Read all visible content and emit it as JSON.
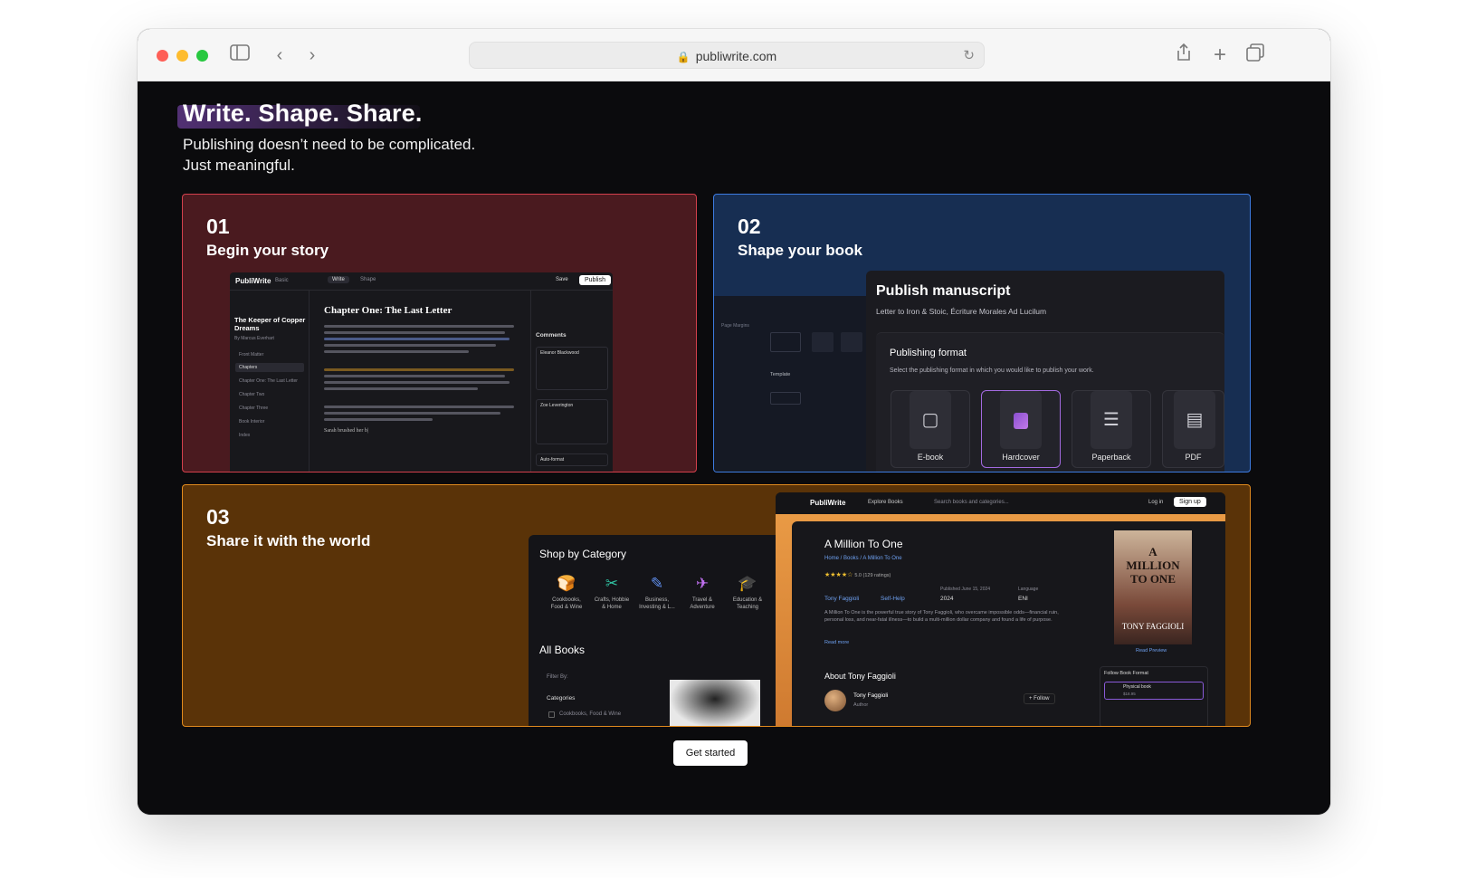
{
  "browser": {
    "url": "publiwrite.com"
  },
  "hero": {
    "title": "Write. Shape. Share.",
    "subtitle_line1": "Publishing doesn’t need to be complicated.",
    "subtitle_line2": "Just meaningful."
  },
  "cards": [
    {
      "number": "01",
      "title": "Begin your story",
      "editor": {
        "logo": "PubliWrite",
        "plan": "Basic",
        "tabs": [
          "Write",
          "Shape"
        ],
        "save": "Save",
        "publish": "Publish",
        "book_title": "The Keeper of Copper Dreams",
        "author": "By Marcus Everhart",
        "sections": [
          "Front Matter",
          "Chapters",
          "Chapter One: The Last Letter",
          "Chapter Two",
          "Chapter Three",
          "Book Interior",
          "Index"
        ],
        "chapter_heading": "Chapter One: The Last Letter",
        "comments_label": "Comments",
        "comment1": "Eleanor Blackwood",
        "comment2": "Zoe Leverington",
        "comment3": "Auto-format",
        "paragraph_end": "Sarah brushed her b|"
      }
    },
    {
      "number": "02",
      "title": "Shape your book",
      "publish": {
        "heading": "Publish manuscript",
        "sub": "Letter to Iron & Stoic, Écriture Morales Ad Lucilum",
        "format_title": "Publishing format",
        "format_desc": "Select the publishing format in which you would like to publish your work.",
        "formats": [
          "E-book",
          "Hardcover",
          "Paperback",
          "PDF"
        ],
        "side_labels": [
          "Page Margins",
          "Template"
        ]
      }
    },
    {
      "number": "03",
      "title": "Share it with the world",
      "store": {
        "shop_title": "Shop by Category",
        "categories": [
          "Cookbooks, Food & Wine",
          "Crafts, Hobbie & Home",
          "Business, Investing & L...",
          "Travel & Adventure",
          "Education & Teaching"
        ],
        "all_books": "All Books",
        "filter_by": "Filter By:",
        "categories_label": "Categories",
        "category_item": "Cookbooks, Food & Wine",
        "nav_logo": "PubliWrite",
        "explore": "Explore Books",
        "search_placeholder": "Search books and categories...",
        "login": "Log in",
        "signup": "Sign up",
        "book_title": "A Million To One",
        "breadcrumb": "Home / Books / A Million To One",
        "rating": "5.0 (129 ratings)",
        "author_name": "Tony Faggioli",
        "publisher": "Self-Help",
        "published_label": "Published June 15, 2024",
        "year": "2024",
        "language_label": "Language",
        "language": "ENI",
        "description": "A Million To One is the powerful true story of Tony Faggioli, who overcame impossible odds—financial ruin, personal loss, and near-fatal illness—to build a multi-million dollar company and found a life of purpose.",
        "read_more": "Read more",
        "about": "About Tony Faggioli",
        "author_role": "Author",
        "follow": "+ Follow",
        "cover_line1": "A",
        "cover_line2": "MILLION",
        "cover_line3": "TO ONE",
        "cover_author": "TONY FAGGIOLI",
        "read_preview": "Read Preview",
        "format_box_title": "Follow Book Format",
        "format_option": "Physical book",
        "format_price": "$18.95"
      }
    }
  ],
  "cta": "Get started"
}
